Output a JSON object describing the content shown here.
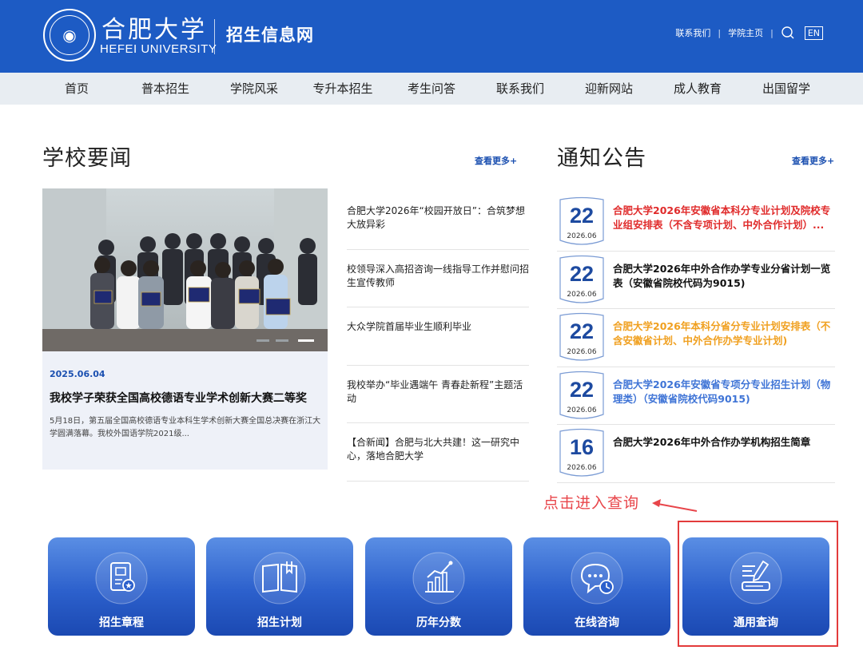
{
  "header": {
    "logo_cn": "合肥大学",
    "logo_en": "HEFEI UNIVERSITY",
    "site_name": "招生信息网",
    "links": [
      "联系我们",
      "学院主页"
    ],
    "lang_button": "EN"
  },
  "nav": [
    "首页",
    "普本招生",
    "学院风采",
    "专升本招生",
    "考生问答",
    "联系我们",
    "迎新网站",
    "成人教育",
    "出国留学"
  ],
  "news": {
    "title": "学校要闻",
    "more": "查看更多+",
    "feature": {
      "date": "2025.06.04",
      "title": "我校学子荣获全国高校德语专业学术创新大赛二等奖",
      "desc": "5月18日，第五届全国高校德语专业本科生学术创新大赛全国总决赛在浙江大学圆满落幕。我校外国语学院2021级..."
    },
    "items": [
      "合肥大学2026年“校园开放日”：合筑梦想 大放异彩",
      "校领导深入高招咨询一线指导工作并慰问招生宣传教师",
      "大众学院首届毕业生顺利毕业",
      "我校举办“毕业遇端午 青春赴新程”主题活动",
      "【合新闻】合肥与北大共建！这一研究中心，落地合肥大学"
    ]
  },
  "notices": {
    "title": "通知公告",
    "more": "查看更多+",
    "items": [
      {
        "day": "22",
        "ym": "2026.06",
        "text": "合肥大学2026年安徽省本科分专业计划及院校专业组安排表（不含专项计划、中外合作计划）...",
        "color": "#e02b2b"
      },
      {
        "day": "22",
        "ym": "2026.06",
        "text": "合肥大学2026年中外合作办学专业分省计划一览表（安徽省院校代码为9015)",
        "color": "#111111"
      },
      {
        "day": "22",
        "ym": "2026.06",
        "text": "合肥大学2026年本科分省分专业计划安排表（不含安徽省计划、中外合作办学专业计划)",
        "color": "#f0a020"
      },
      {
        "day": "22",
        "ym": "2026.06",
        "text": "合肥大学2026年安徽省专项分专业招生计划（物理类）（安徽省院校代码9015)",
        "color": "#3f74d6"
      },
      {
        "day": "16",
        "ym": "2026.06",
        "text": "合肥大学2026年中外合作办学机构招生简章",
        "color": "#111111"
      }
    ]
  },
  "annotation": {
    "text": "点击进入查询",
    "color": "#e8454a"
  },
  "tiles": [
    {
      "label": "招生章程",
      "icon": "certificate-icon"
    },
    {
      "label": "招生计划",
      "icon": "book-plan-icon"
    },
    {
      "label": "历年分数",
      "icon": "bar-chart-icon"
    },
    {
      "label": "在线咨询",
      "icon": "chat-clock-icon"
    },
    {
      "label": "通用查询",
      "icon": "query-book-icon"
    }
  ],
  "colors": {
    "header_blue": "#1d5bc4",
    "nav_bg": "#e8edf2",
    "tile_blue": "#2c60cc",
    "link_blue": "#1a4fb0"
  }
}
